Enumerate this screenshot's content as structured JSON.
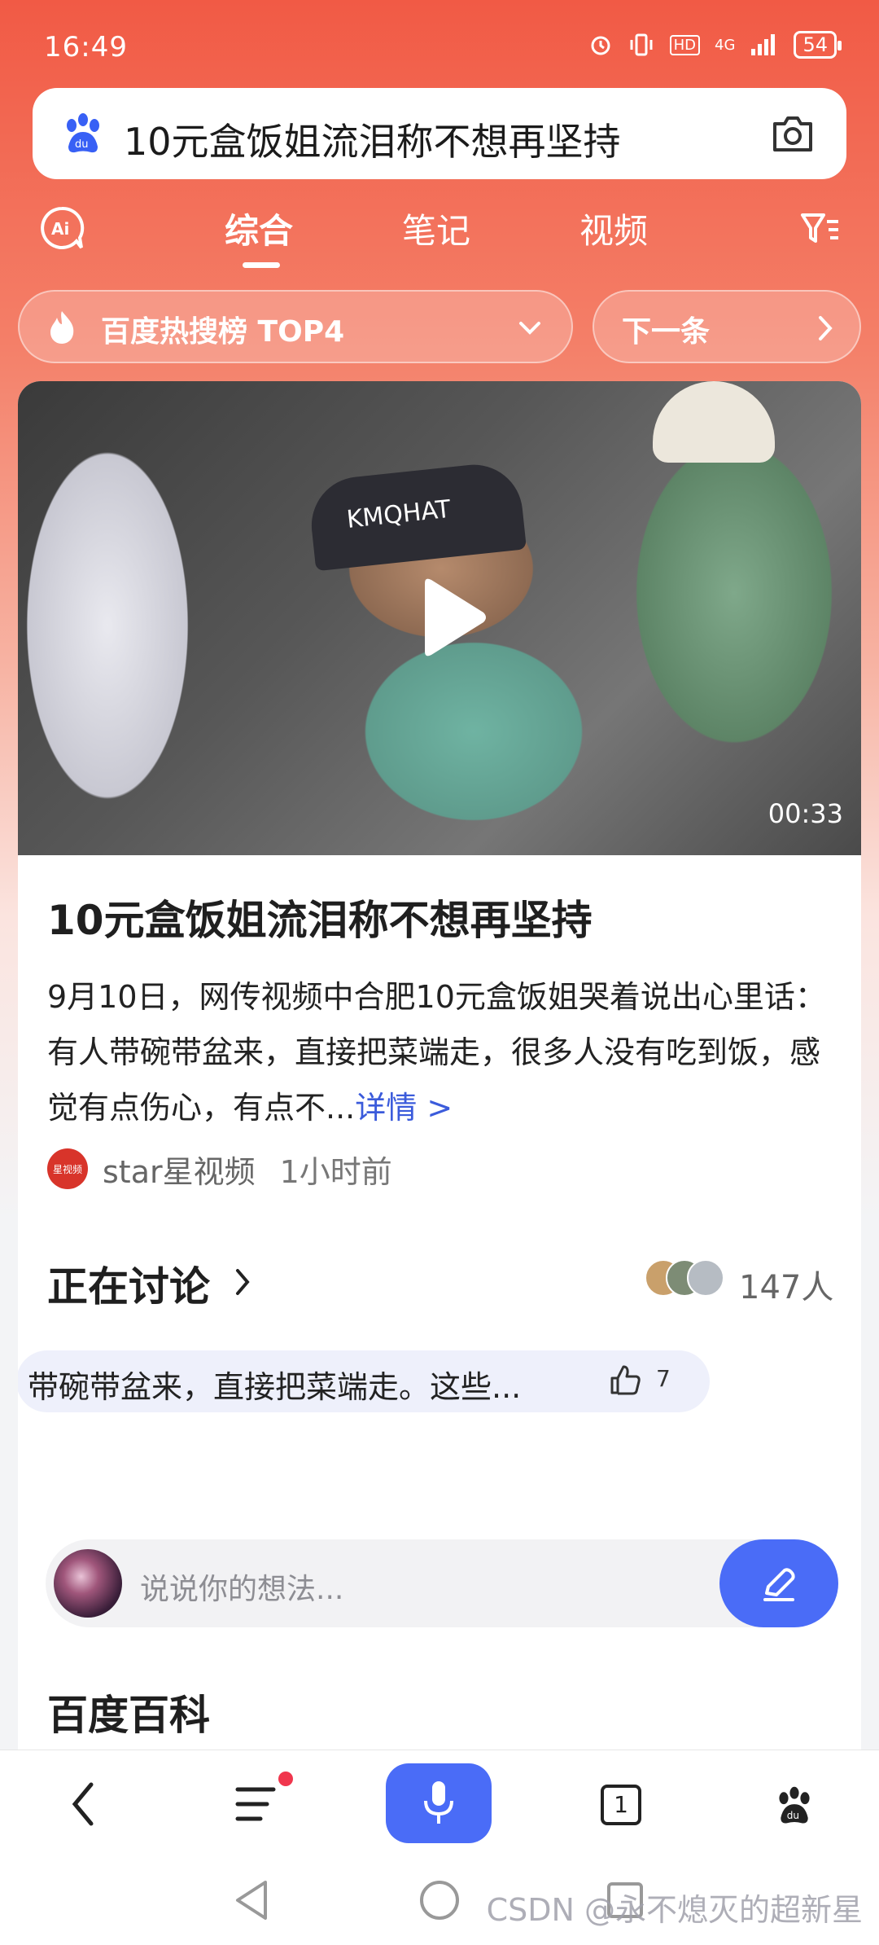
{
  "status_bar": {
    "time": "16:49",
    "network": "4G",
    "battery": "54"
  },
  "search": {
    "query": "10元盒饭姐流泪称不想再坚持"
  },
  "tabs": [
    {
      "label": "综合",
      "active": true
    },
    {
      "label": "笔记",
      "active": false
    },
    {
      "label": "视频",
      "active": false
    }
  ],
  "hot_chip": {
    "label": "百度热搜榜 TOP4"
  },
  "next_chip": {
    "label": "下一条"
  },
  "video": {
    "cap_text": "KMQHAT",
    "duration": "00:33"
  },
  "article": {
    "title": "10元盒饭姐流泪称不想再坚持",
    "body": "9月10日，网传视频中合肥10元盒饭姐哭着说出心里话：有人带碗带盆来，直接把菜端走，很多人没有吃到饭，感觉有点伤心，有点不...",
    "more_label": "详情 >",
    "source_logo_text": "星视频",
    "source_name": "star星视频",
    "source_time": "1小时前"
  },
  "discussion": {
    "title": "正在讨论",
    "participant_count": "147人",
    "comment_text": "带碗带盆来，直接把菜端走。这些...",
    "like_count": "7"
  },
  "comment_input": {
    "placeholder": "说说你的想法..."
  },
  "baike": {
    "title": "百度百科"
  },
  "bottom_nav": {
    "tabs_count": "1"
  },
  "watermark": "CSDN @永不熄灭的超新星",
  "colors": {
    "accent_blue": "#4a6cf7",
    "brand_red": "#f15a45"
  }
}
